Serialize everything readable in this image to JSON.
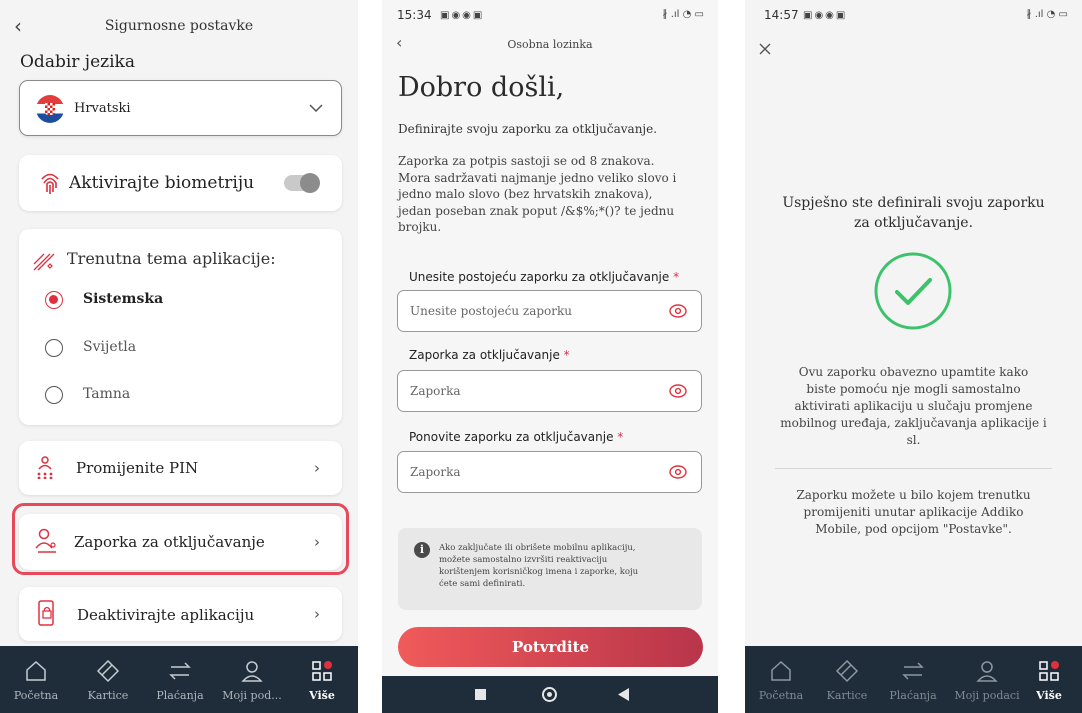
{
  "screen1": {
    "header_title": "Sigurnosne postavke",
    "language_heading": "Odabir jezika",
    "language_selected": "Hrvatski",
    "biometrics_label": "Aktivirajte biometriju",
    "theme_heading": "Trenutna tema aplikacije:",
    "theme_options": [
      "Sistemska",
      "Svijetla",
      "Tamna"
    ],
    "theme_selected": "Sistemska",
    "change_pin": "Promijenite PIN",
    "unlock_password": "Zaporka za otključavanje",
    "deactivate": "Deaktivirajte aplikaciju",
    "nav": [
      "Početna",
      "Kartice",
      "Plaćanja",
      "Moji pod...",
      "Više"
    ]
  },
  "screen2": {
    "status_time": "15:34",
    "header_title": "Osobna lozinka",
    "welcome": "Dobro došli,",
    "subtitle": "Definirajte svoju zaporku za otključavanje.",
    "rules": [
      "Zaporka za potpis sastoji se od 8 znakova.",
      "Mora sadržavati najmanje jedno veliko slovo i",
      "jedno malo slovo (bez hrvatskih znakova),",
      "jedan poseban znak poput /&$%;*()? te jednu",
      "brojku."
    ],
    "field1_label": "Unesite postojeću zaporku za otključavanje",
    "field1_placeholder": "Unesite postojeću zaporku",
    "field2_label": "Zaporka za otključavanje",
    "field2_placeholder": "Zaporka",
    "field3_label": "Ponovite zaporku za otključavanje",
    "field3_placeholder": "Zaporka",
    "required_mark": "*",
    "info_lines": [
      "Ako zaključate ili obrišete mobilnu aplikaciju,",
      "možete samostalno izvršiti reaktivaciju",
      "korištenjem korisničkog imena i zaporke, koju",
      "ćete sami definirati."
    ],
    "confirm_button": "Potvrdite"
  },
  "screen3": {
    "status_time": "14:57",
    "success_lines": [
      "Uspješno ste definirali svoju zaporku",
      "za otključavanje."
    ],
    "remember_lines": [
      "Ovu zaporku obavezno upamtite kako",
      "biste pomoću nje mogli samostalno",
      "aktivirati aplikaciju u slučaju promjene",
      "mobilnog uređaja, zaključavanja aplikacije i",
      "sl."
    ],
    "change_lines": [
      "Zaporku možete u bilo kojem trenutku",
      "promijeniti unutar aplikacije Addiko",
      "Mobile, pod opcijom \"Postavke\"."
    ],
    "nav": [
      "Početna",
      "Kartice",
      "Plaćanja",
      "Moji podaci",
      "Više"
    ]
  },
  "colors": {
    "accent_red": "#e0303e",
    "highlight_outline": "#e8495a",
    "navbar": "#1f2d3a",
    "success_green": "#3cc26a",
    "button_gradient_start": "#f05a5a",
    "button_gradient_end": "#b8354a"
  },
  "icons": [
    "back-arrow-icon",
    "croatia-flag-icon",
    "chevron-down-icon",
    "fingerprint-icon",
    "theme-icon",
    "pin-icon",
    "person-key-icon",
    "phone-lock-icon",
    "chevron-right-icon",
    "home-icon",
    "card-icon",
    "transfer-icon",
    "person-icon",
    "grid-icon",
    "eye-icon",
    "info-icon",
    "check-circle-icon",
    "close-icon"
  ]
}
